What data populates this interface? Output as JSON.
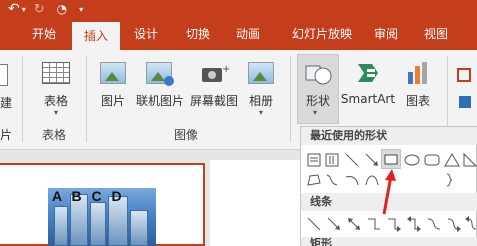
{
  "colors": {
    "accent": "#c43e1c",
    "highlight_arrow": "#e02020"
  },
  "tabs": [
    "开始",
    "插入",
    "设计",
    "切换",
    "动画",
    "幻灯片放映",
    "审阅",
    "视图"
  ],
  "active_tab": "插入",
  "ribbon": {
    "left_clipped": {
      "label_top": "建",
      "label_bottom": "片"
    },
    "table_group": {
      "button_label": "表格",
      "group_label": "表格"
    },
    "image_group": {
      "buttons": [
        "图片",
        "联机图片",
        "屏幕截图",
        "相册"
      ],
      "group_label": "图像"
    },
    "illustration": {
      "shapes_label": "形状",
      "smartart_label": "SmartArt",
      "chart_label": "图表"
    }
  },
  "gallery": {
    "recent_header": "最近使用的形状",
    "lines_header": "线条",
    "rect_header": "矩形"
  },
  "slide": {
    "thumb_text": "A B C D"
  }
}
